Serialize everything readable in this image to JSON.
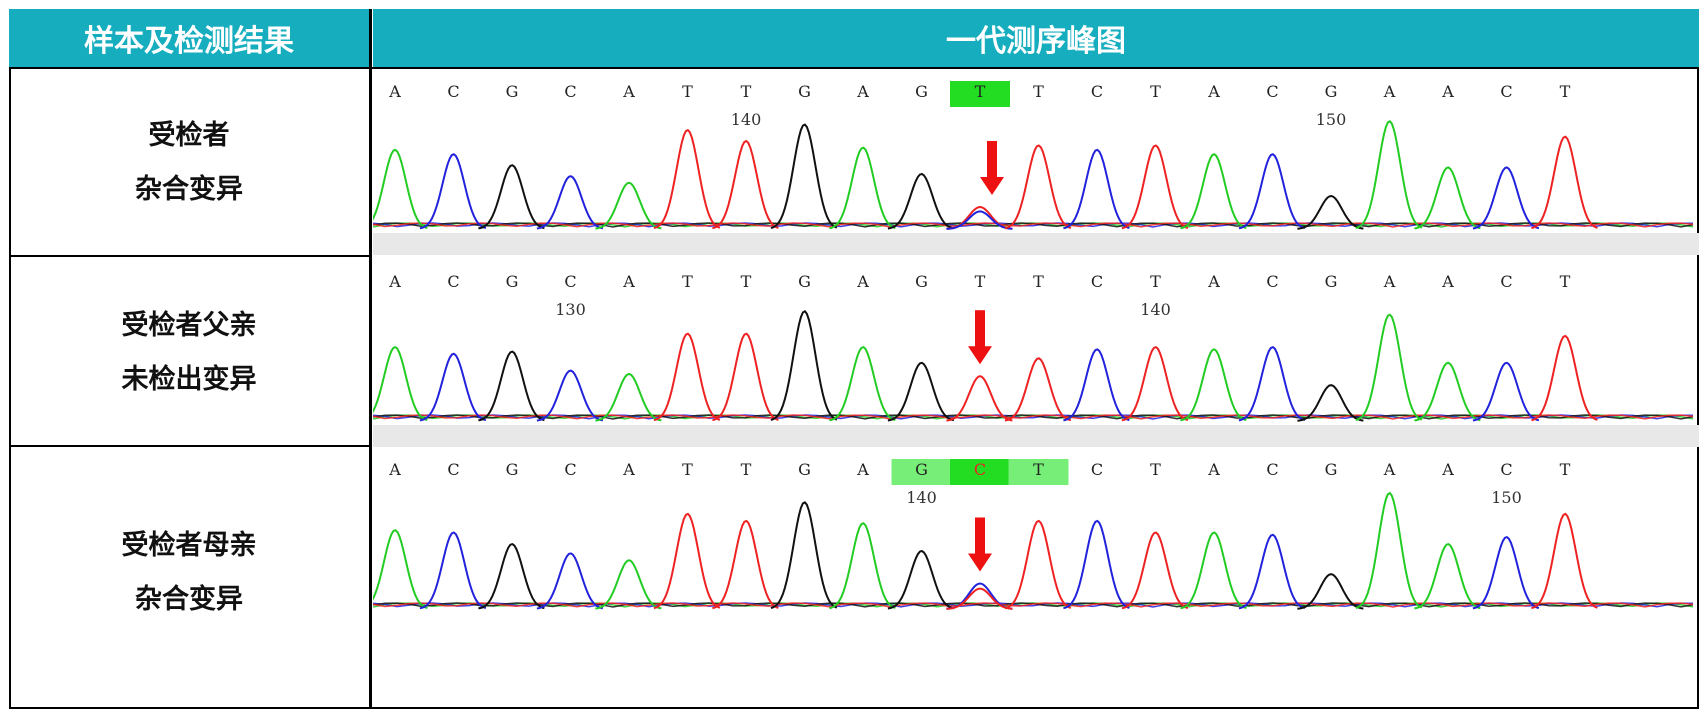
{
  "header": {
    "col1": "样本及检测结果",
    "col2": "一代测序峰图"
  },
  "colors": {
    "header_bg": "#16aebf",
    "A": "#22cc22",
    "C": "#2222dd",
    "G": "#111111",
    "T": "#ee2222",
    "arrow": "#ee1111",
    "highlight_strong": "#22dd22",
    "highlight_light": "#77ee77"
  },
  "rows": [
    {
      "label_line1": "受检者",
      "label_line2": "杂合变异",
      "bases": [
        "A",
        "C",
        "G",
        "C",
        "A",
        "T",
        "T",
        "G",
        "A",
        "G",
        "T",
        "T",
        "C",
        "T",
        "A",
        "C",
        "G",
        "A",
        "A",
        "C",
        "T"
      ],
      "highlight": [
        {
          "index": 10,
          "strength": "strong"
        }
      ],
      "positions": [
        {
          "index": 6,
          "label": "140"
        },
        {
          "index": 16,
          "label": "150"
        }
      ],
      "heights": [
        0.72,
        0.68,
        0.58,
        0.48,
        0.42,
        0.9,
        0.8,
        0.95,
        0.74,
        0.5,
        0.2,
        0.76,
        0.72,
        0.76,
        0.68,
        0.68,
        0.3,
        0.98,
        0.56,
        0.56,
        0.84
      ],
      "het_index": 10,
      "secondary_base": "C"
    },
    {
      "label_line1": "受检者父亲",
      "label_line2": "未检出变异",
      "bases": [
        "A",
        "C",
        "G",
        "C",
        "A",
        "T",
        "T",
        "G",
        "A",
        "G",
        "T",
        "T",
        "C",
        "T",
        "A",
        "C",
        "G",
        "A",
        "A",
        "C",
        "T"
      ],
      "highlight": [],
      "positions": [
        {
          "index": 3,
          "label": "130"
        },
        {
          "index": 13,
          "label": "140"
        }
      ],
      "heights": [
        0.66,
        0.6,
        0.62,
        0.45,
        0.42,
        0.78,
        0.78,
        0.98,
        0.66,
        0.52,
        0.4,
        0.56,
        0.64,
        0.66,
        0.64,
        0.66,
        0.32,
        0.95,
        0.52,
        0.52,
        0.76
      ],
      "het_index": -1,
      "secondary_base": ""
    },
    {
      "label_line1": "受检者母亲",
      "label_line2": "杂合变异",
      "bases": [
        "A",
        "C",
        "G",
        "C",
        "A",
        "T",
        "T",
        "G",
        "A",
        "G",
        "C",
        "T",
        "C",
        "T",
        "A",
        "C",
        "G",
        "A",
        "A",
        "C",
        "T"
      ],
      "highlight": [
        {
          "index": 9,
          "strength": "light"
        },
        {
          "index": 10,
          "strength": "strong"
        },
        {
          "index": 11,
          "strength": "light"
        }
      ],
      "positions": [
        {
          "index": 9,
          "label": "140"
        },
        {
          "index": 19,
          "label": "150"
        }
      ],
      "heights": [
        0.68,
        0.66,
        0.56,
        0.48,
        0.42,
        0.82,
        0.76,
        0.92,
        0.74,
        0.5,
        0.22,
        0.76,
        0.76,
        0.66,
        0.66,
        0.64,
        0.3,
        1.0,
        0.56,
        0.62,
        0.82
      ],
      "het_index": 10,
      "secondary_base": "T"
    }
  ]
}
